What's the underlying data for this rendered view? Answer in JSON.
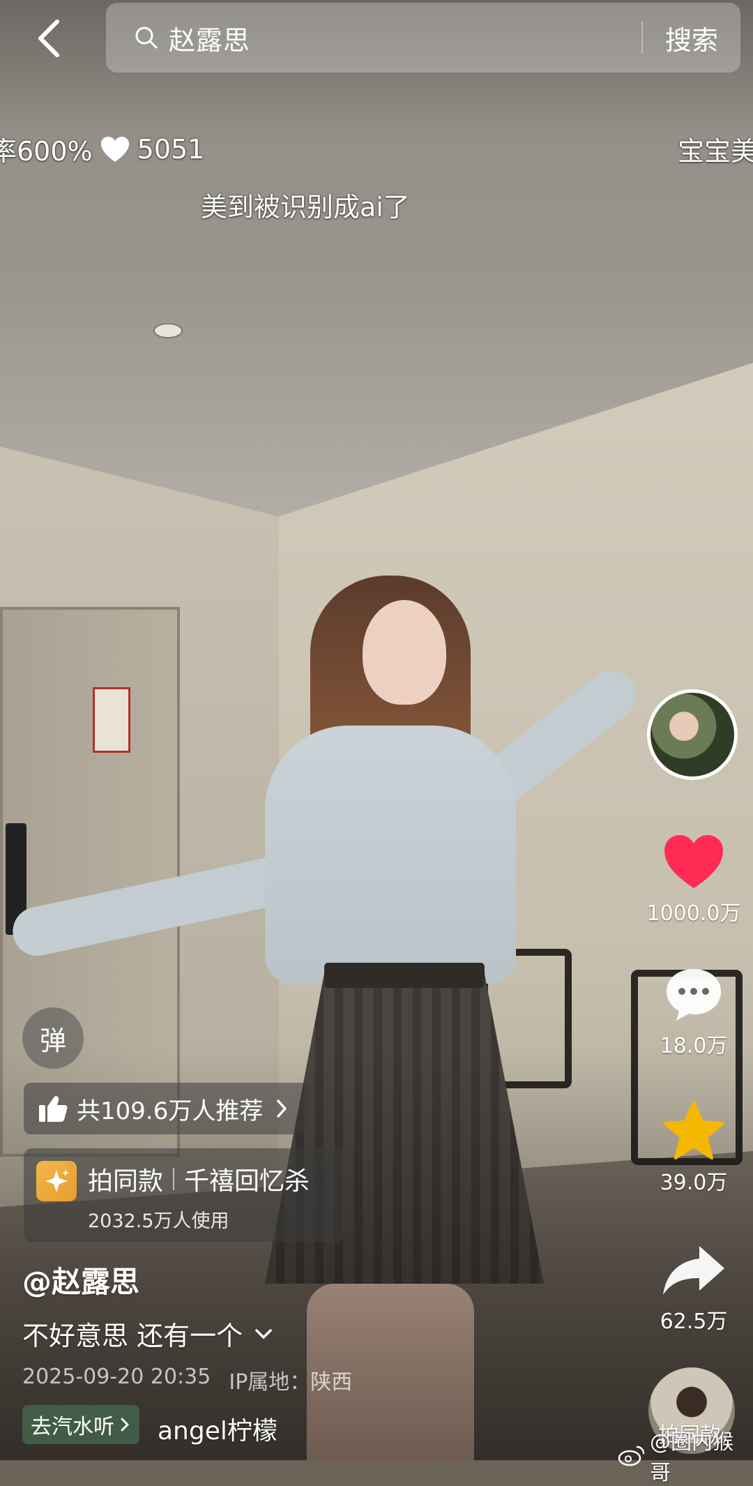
{
  "search": {
    "query": "赵露思",
    "button_label": "搜索"
  },
  "danmaku": {
    "rate": "率600%",
    "likes": "5051",
    "right_text": "宝宝美",
    "line2": "美到被识别成ai了"
  },
  "actions": {
    "likes": "1000.0万",
    "comments": "18.0万",
    "favorites": "39.0万",
    "shares": "62.5万"
  },
  "danmaku_toggle": {
    "label": "弹"
  },
  "recommend": {
    "label": "共109.6万人推荐"
  },
  "effect": {
    "prefix": "拍同款",
    "name": "千禧回忆杀",
    "usage": "2032.5万人使用"
  },
  "author": {
    "handle": "@赵露思"
  },
  "caption": {
    "text": "不好意思 还有一个"
  },
  "meta": {
    "datetime": "2025-09-20 20:35",
    "ip_location": "IP属地：陕西"
  },
  "music": {
    "tag": "去汽水听",
    "title": "angel柠檬"
  },
  "bottom_avatar": {
    "label": "拍同款"
  },
  "watermark": {
    "text": "@圈内猴哥"
  },
  "colors": {
    "like_red": "#fe2c55",
    "star_yellow": "#f5b800",
    "music_tag_green": "#466e50"
  },
  "icons": [
    "back-arrow-icon",
    "search-icon",
    "heart-icon",
    "comment-icon",
    "star-icon",
    "share-icon",
    "thumbs-up-icon",
    "chevron-right-icon",
    "chevron-down-icon",
    "sparkle-icon",
    "weibo-icon"
  ]
}
